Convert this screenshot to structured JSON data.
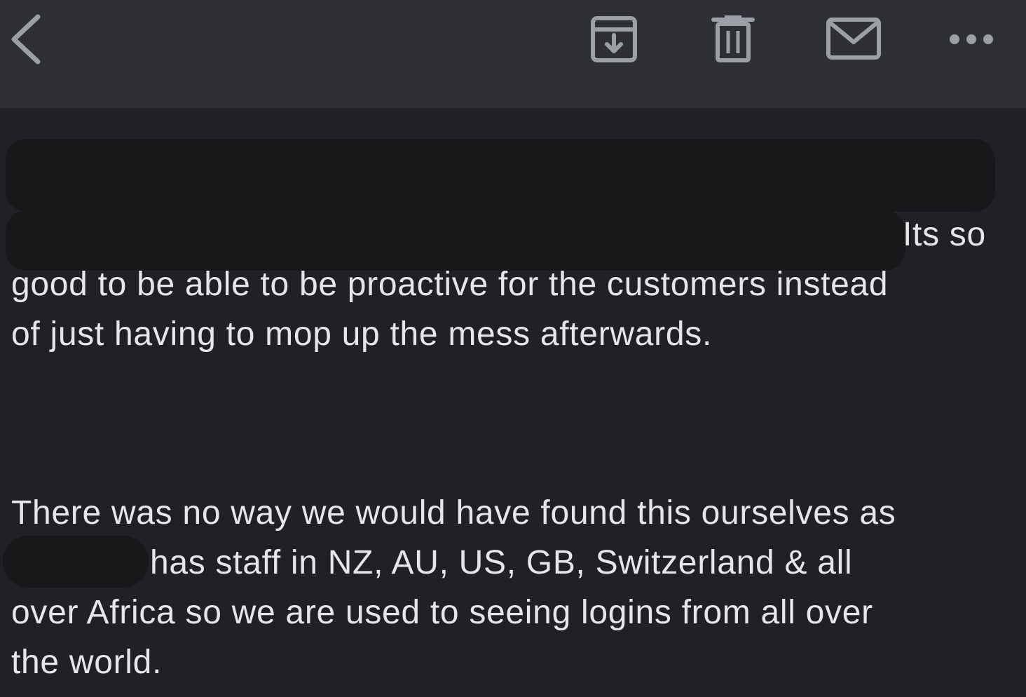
{
  "toolbar": {
    "icons": [
      "chevron-left-icon",
      "archive-icon",
      "trash-icon",
      "mail-icon",
      "more-horizontal-icon"
    ]
  },
  "message": {
    "lines": [
      "Its so",
      "good to be able to be proactive for the customers instead",
      "of just having to mop up the mess afterwards.",
      "There was no way we would have found this ourselves as",
      "has staff in NZ, AU, US, GB, Switzerland & all",
      "over Africa so we are used to seeing logins from all over",
      "the world."
    ]
  },
  "colors": {
    "background": "#202124",
    "toolbar": "#2f3033",
    "icon": "#9aa0a6",
    "text": "#e6e6e8",
    "redaction": "#18181a"
  }
}
